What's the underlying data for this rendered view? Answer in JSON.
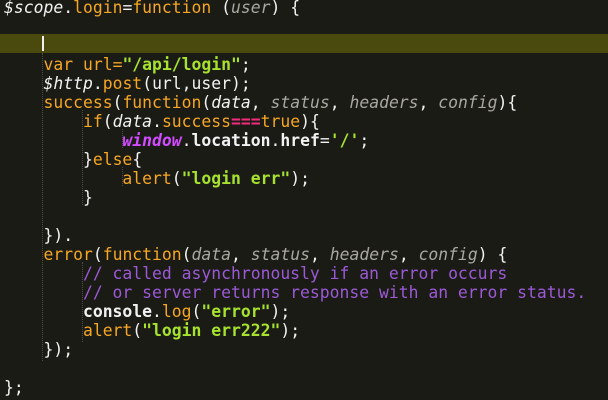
{
  "editor": {
    "lines": [
      {
        "tokens": [
          {
            "t": "$scope",
            "c": "white-i"
          },
          {
            "t": ".",
            "c": "plain"
          },
          {
            "t": "login",
            "c": "orange"
          },
          {
            "t": "=",
            "c": "plain"
          },
          {
            "t": "function",
            "c": "orange"
          },
          {
            "t": " (",
            "c": "plain"
          },
          {
            "t": "user",
            "c": "grey-i"
          },
          {
            "t": ") {",
            "c": "plain"
          }
        ]
      },
      {
        "tokens": []
      },
      {
        "tokens": [],
        "current": true
      },
      {
        "tokens": [
          {
            "t": "    ",
            "c": "plain"
          },
          {
            "t": "var",
            "c": "orange"
          },
          {
            "t": " url=",
            "c": "orange"
          },
          {
            "t": "\"/api/login\"",
            "c": "green-b"
          },
          {
            "t": ";",
            "c": "plain"
          }
        ]
      },
      {
        "tokens": [
          {
            "t": "    ",
            "c": "plain"
          },
          {
            "t": "$http",
            "c": "white-i"
          },
          {
            "t": ".",
            "c": "plain"
          },
          {
            "t": "post",
            "c": "orange"
          },
          {
            "t": "(",
            "c": "plain"
          },
          {
            "t": "url",
            "c": "plain"
          },
          {
            "t": ",",
            "c": "plain"
          },
          {
            "t": "user",
            "c": "plain"
          },
          {
            "t": ");",
            "c": "plain"
          }
        ]
      },
      {
        "tokens": [
          {
            "t": "    ",
            "c": "plain"
          },
          {
            "t": "success",
            "c": "orange"
          },
          {
            "t": "(",
            "c": "plain"
          },
          {
            "t": "function",
            "c": "orange"
          },
          {
            "t": "(",
            "c": "plain"
          },
          {
            "t": "data",
            "c": "white-i"
          },
          {
            "t": ", ",
            "c": "plain"
          },
          {
            "t": "status",
            "c": "grey-i"
          },
          {
            "t": ", ",
            "c": "plain"
          },
          {
            "t": "headers",
            "c": "grey-i"
          },
          {
            "t": ", ",
            "c": "plain"
          },
          {
            "t": "config",
            "c": "grey-i"
          },
          {
            "t": "){",
            "c": "plain"
          }
        ]
      },
      {
        "tokens": [
          {
            "t": "        ",
            "c": "plain"
          },
          {
            "t": "if",
            "c": "orange"
          },
          {
            "t": "(",
            "c": "plain"
          },
          {
            "t": "data",
            "c": "white-i"
          },
          {
            "t": ".",
            "c": "plain"
          },
          {
            "t": "success",
            "c": "orange"
          },
          {
            "t": "===",
            "c": "pink-b"
          },
          {
            "t": "true",
            "c": "orange"
          },
          {
            "t": "){",
            "c": "plain"
          }
        ]
      },
      {
        "tokens": [
          {
            "t": "            ",
            "c": "plain"
          },
          {
            "t": "window",
            "c": "purple-bi"
          },
          {
            "t": ".",
            "c": "plain"
          },
          {
            "t": "location",
            "c": "white-b"
          },
          {
            "t": ".",
            "c": "plain"
          },
          {
            "t": "href",
            "c": "white-b"
          },
          {
            "t": "=",
            "c": "plain"
          },
          {
            "t": "'/'",
            "c": "green-b"
          },
          {
            "t": ";",
            "c": "plain"
          }
        ]
      },
      {
        "tokens": [
          {
            "t": "        ",
            "c": "plain"
          },
          {
            "t": "}",
            "c": "plain"
          },
          {
            "t": "else",
            "c": "orange"
          },
          {
            "t": "{",
            "c": "plain"
          }
        ]
      },
      {
        "tokens": [
          {
            "t": "            ",
            "c": "plain"
          },
          {
            "t": "alert",
            "c": "orange"
          },
          {
            "t": "(",
            "c": "plain"
          },
          {
            "t": "\"login err\"",
            "c": "green-b"
          },
          {
            "t": ");",
            "c": "plain"
          }
        ]
      },
      {
        "tokens": [
          {
            "t": "        ",
            "c": "plain"
          },
          {
            "t": "}",
            "c": "plain"
          }
        ]
      },
      {
        "tokens": []
      },
      {
        "tokens": [
          {
            "t": "    ",
            "c": "plain"
          },
          {
            "t": "}).",
            "c": "plain"
          }
        ]
      },
      {
        "tokens": [
          {
            "t": "    ",
            "c": "plain"
          },
          {
            "t": "error",
            "c": "orange"
          },
          {
            "t": "(",
            "c": "plain"
          },
          {
            "t": "function",
            "c": "orange"
          },
          {
            "t": "(",
            "c": "plain"
          },
          {
            "t": "data",
            "c": "grey-i"
          },
          {
            "t": ", ",
            "c": "plain"
          },
          {
            "t": "status",
            "c": "grey-i"
          },
          {
            "t": ", ",
            "c": "plain"
          },
          {
            "t": "headers",
            "c": "grey-i"
          },
          {
            "t": ", ",
            "c": "plain"
          },
          {
            "t": "config",
            "c": "grey-i"
          },
          {
            "t": ") {",
            "c": "plain"
          }
        ]
      },
      {
        "tokens": [
          {
            "t": "        ",
            "c": "plain"
          },
          {
            "t": "// called asynchronously if an error occurs",
            "c": "comment"
          }
        ]
      },
      {
        "tokens": [
          {
            "t": "        ",
            "c": "plain"
          },
          {
            "t": "// or server returns response with an error status.",
            "c": "comment"
          }
        ]
      },
      {
        "tokens": [
          {
            "t": "        ",
            "c": "plain"
          },
          {
            "t": "console",
            "c": "white-b"
          },
          {
            "t": ".",
            "c": "plain"
          },
          {
            "t": "log",
            "c": "orange"
          },
          {
            "t": "(",
            "c": "plain"
          },
          {
            "t": "\"error\"",
            "c": "green-b"
          },
          {
            "t": ");",
            "c": "plain"
          }
        ]
      },
      {
        "tokens": [
          {
            "t": "        ",
            "c": "plain"
          },
          {
            "t": "alert",
            "c": "orange"
          },
          {
            "t": "(",
            "c": "plain"
          },
          {
            "t": "\"login err222\"",
            "c": "green-b"
          },
          {
            "t": ");",
            "c": "plain"
          }
        ]
      },
      {
        "tokens": [
          {
            "t": "    ",
            "c": "plain"
          },
          {
            "t": "});",
            "c": "plain"
          }
        ]
      },
      {
        "tokens": []
      },
      {
        "tokens": [
          {
            "t": "};",
            "c": "plain"
          }
        ]
      }
    ]
  },
  "colors": {
    "background": "#1b1b16",
    "current_line": "#4a4a0e",
    "keyword": "#f5a623",
    "string": "#a6e22e",
    "comment": "#9b59d6",
    "operator": "#f22b7a",
    "builtin": "#d24bff"
  }
}
